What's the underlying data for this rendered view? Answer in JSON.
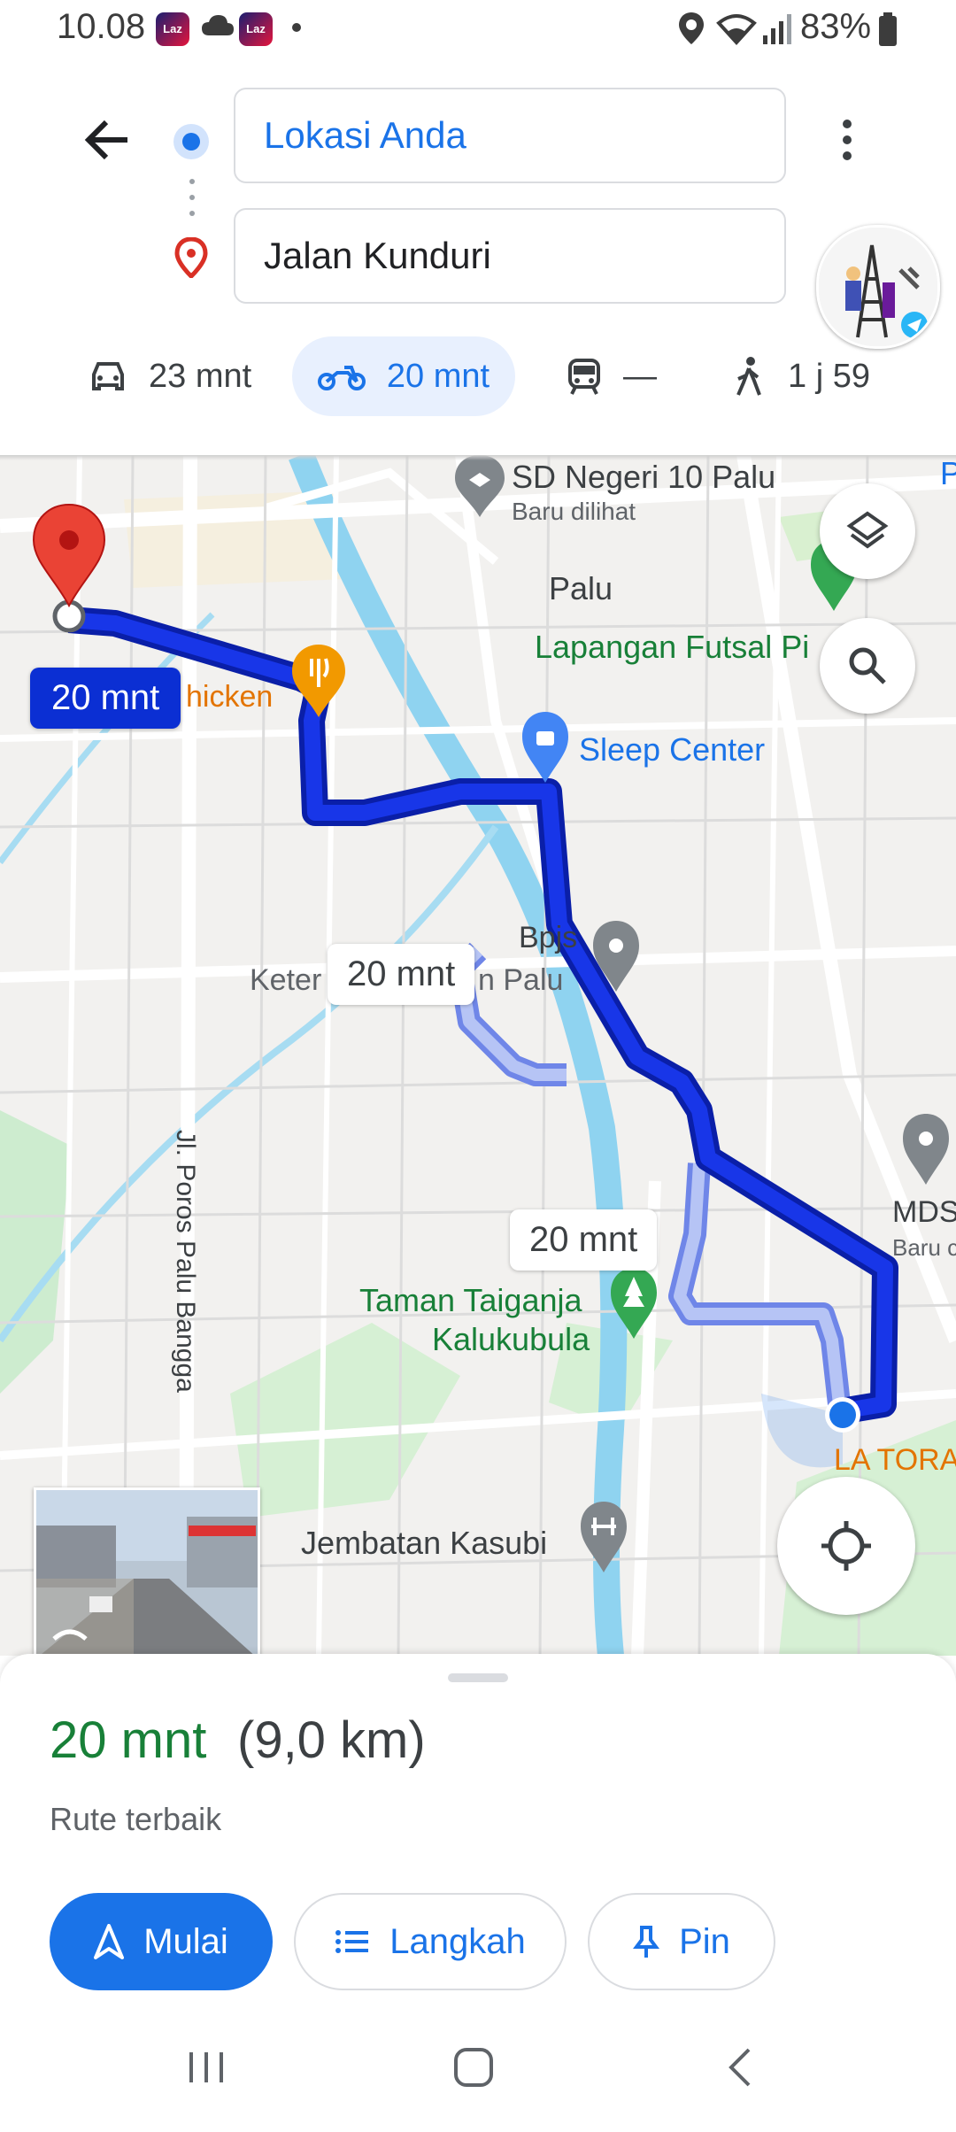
{
  "status_bar": {
    "time": "10.08",
    "laz_label": "Laz",
    "battery": "83%"
  },
  "header": {
    "origin": "Lokasi Anda",
    "destination": "Jalan Kunduri"
  },
  "modes": [
    {
      "name": "car",
      "time": "23 mnt"
    },
    {
      "name": "motorcycle",
      "time": "20 mnt",
      "selected": true
    },
    {
      "name": "transit",
      "time": "—"
    },
    {
      "name": "walk",
      "time": "1 j 59"
    }
  ],
  "map": {
    "route_bubble_main": "20 mnt",
    "route_bubble_alt1": "20 mnt",
    "route_bubble_alt2": "20 mnt",
    "labels": {
      "sd_negeri": "SD Negeri 10 Palu",
      "baru_dilihat": "Baru dilihat",
      "palu": "Palu",
      "futsal": "Lapangan Futsal Pi",
      "chicken": "hicken",
      "sleep_center": "Sleep Center",
      "bpjs": "Bpjs",
      "keter": "Keter",
      "n_palu": "n Palu",
      "poros": "Jl. Poros Palu Bangga",
      "taman_1": "Taman Taiganja",
      "taman_2": "Kalukubula",
      "jembatan": "Jembatan Kasubi",
      "mds": "MDS",
      "baru": "Baru c",
      "la_tora": "LA TORA",
      "p_edge": "P"
    }
  },
  "sheet": {
    "eta_time": "20 mnt",
    "eta_distance": "(9,0 km)",
    "route_note": "Rute terbaik",
    "start_label": "Mulai",
    "steps_label": "Langkah",
    "pin_label": "Pin"
  },
  "colors": {
    "route_primary": "#0b2fd3",
    "route_alt": "#a8b7f0",
    "accent": "#1a73e8",
    "eta_green": "#188038"
  }
}
